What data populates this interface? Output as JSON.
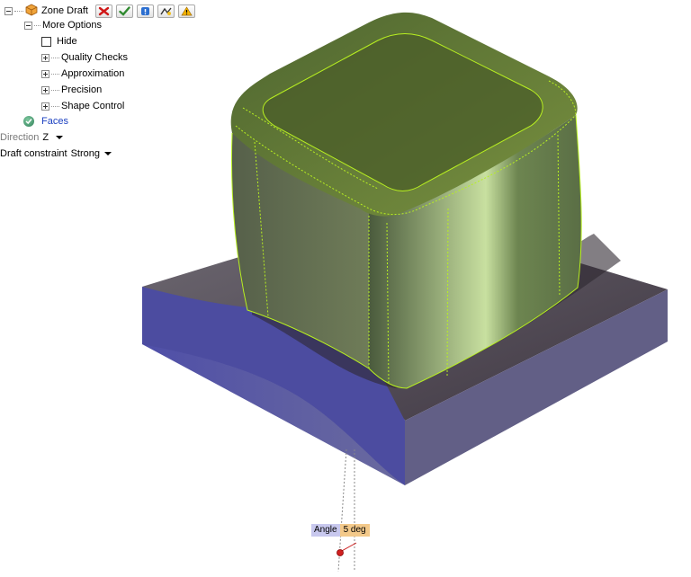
{
  "tree": {
    "root_label": "Zone Draft",
    "more_options": "More Options",
    "hide": "Hide",
    "quality_checks": "Quality Checks",
    "approximation": "Approximation",
    "precision": "Precision",
    "shape_control": "Shape Control",
    "faces": "Faces",
    "direction_label": "Direction",
    "direction_value": "Z",
    "draft_label": "Draft constraint",
    "draft_value": "Strong"
  },
  "toolbar_icons": [
    "cancel-icon",
    "ok-icon",
    "info-icon",
    "preview-icon",
    "warning-icon"
  ],
  "angle": {
    "label": "Angle",
    "value": "5 deg"
  },
  "colors": {
    "base_dark": "#4f4650",
    "base_side": "#5a58a8",
    "cube_green": "#5d7c3a",
    "edge_line": "#b8f020"
  }
}
